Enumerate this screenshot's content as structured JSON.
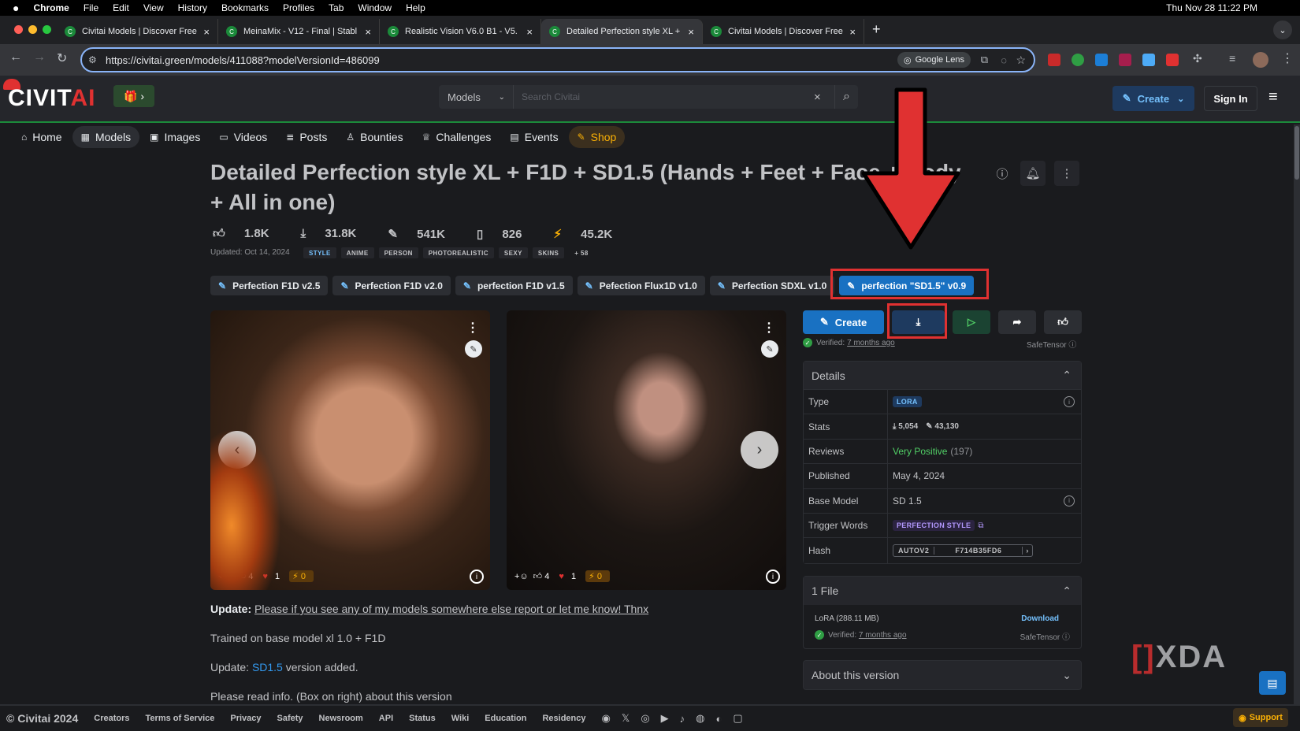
{
  "macbar": {
    "apple": "",
    "items": [
      "Chrome",
      "File",
      "Edit",
      "View",
      "History",
      "Bookmarks",
      "Profiles",
      "Tab",
      "Window",
      "Help"
    ],
    "clock": "Thu Nov 28  11:22 PM"
  },
  "browser": {
    "tabs": [
      {
        "label": "Civitai Models | Discover Free"
      },
      {
        "label": "MeinaMix - V12 - Final | Stabl"
      },
      {
        "label": "Realistic Vision V6.0 B1 - V5."
      },
      {
        "label": "Detailed Perfection style XL +"
      },
      {
        "label": "Civitai Models | Discover Free"
      }
    ],
    "active_tab": 3,
    "new_tab": "+",
    "url": "https://civitai.green/models/411088?modelVersionId=486099",
    "lens_label": "Google Lens"
  },
  "header": {
    "logo_a": "CIVIT",
    "logo_b": "AI",
    "seasonal": "🎁 ›",
    "search_select": "Models",
    "search_placeholder": "Search Civitai",
    "create_label": "Create",
    "signin_label": "Sign In"
  },
  "nav": {
    "items": [
      {
        "label": "Home",
        "icon": "⌂"
      },
      {
        "label": "Models",
        "icon": "▦"
      },
      {
        "label": "Images",
        "icon": "▣"
      },
      {
        "label": "Videos",
        "icon": "▭"
      },
      {
        "label": "Posts",
        "icon": "≣"
      },
      {
        "label": "Bounties",
        "icon": "♙"
      },
      {
        "label": "Challenges",
        "icon": "♕"
      },
      {
        "label": "Events",
        "icon": "▤"
      },
      {
        "label": "Shop",
        "icon": "✎"
      }
    ],
    "active": 1
  },
  "model": {
    "title": "Detailed Perfection style XL + F1D + SD1.5 (Hands + Feet + Face + Body + All in one)",
    "stats": {
      "likes": "1.8K",
      "downloads": "31.8K",
      "generations": "541K",
      "collected": "826",
      "buzz": "45.2K"
    },
    "updated": "Updated: Oct 14, 2024",
    "tags": [
      "STYLE",
      "ANIME",
      "PERSON",
      "PHOTOREALISTIC",
      "SEXY",
      "SKINS",
      "+ 58"
    ],
    "versions": [
      "Perfection F1D v2.5",
      "Perfection F1D v2.0",
      "perfection F1D v1.5",
      "Pefection Flux1D v1.0",
      "Perfection SDXL v1.0",
      "perfection \"SD1.5\" v0.9"
    ],
    "active_version": 5
  },
  "gallery": {
    "image1": {
      "reactions": {
        "add": "+☺",
        "likes": "4",
        "hearts": "1",
        "buzz": "0"
      }
    },
    "image2": {
      "reactions": {
        "add": "+☺",
        "likes": "4",
        "hearts": "1",
        "buzz": "0"
      }
    }
  },
  "description": {
    "update_label": "Update",
    "update_link": "Please if you see any of my models somewhere else report or let me know! Thnx",
    "trained": "Trained on base model xl 1.0 + F1D",
    "update2_pre": "Update: ",
    "update2_link": "SD1.5",
    "update2_post": " version added.",
    "read_info": "Please read info. (Box on right) about this version"
  },
  "actions": {
    "create_label": "Create",
    "verified_label": "Verified:",
    "verified_when": "7 months ago",
    "safetensor": "SafeTensor"
  },
  "details": {
    "title": "Details",
    "rows": {
      "type_k": "Type",
      "type_v": "LORA",
      "stats_k": "Stats",
      "stats_dl": "5,054",
      "stats_gen": "43,130",
      "reviews_k": "Reviews",
      "reviews_v": "Very Positive",
      "reviews_n": "(197)",
      "published_k": "Published",
      "published_v": "May 4, 2024",
      "base_k": "Base Model",
      "base_v": "SD 1.5",
      "trigger_k": "Trigger Words",
      "trigger_v": "PERFECTION STYLE",
      "hash_k": "Hash",
      "hash_type": "AUTOV2",
      "hash_v": "F714B35FD6"
    }
  },
  "files": {
    "title": "1 File",
    "file_name": "LoRA (288.11 MB)",
    "download": "Download",
    "verified_label": "Verified:",
    "verified_when": "7 months ago",
    "safetensor": "SafeTensor"
  },
  "about": {
    "title": "About this version"
  },
  "watermark": {
    "bracket": "[]",
    "text": "XDA"
  },
  "footer": {
    "copyright": "© Civitai 2024",
    "links": [
      "Creators",
      "Terms of Service",
      "Privacy",
      "Safety",
      "Newsroom",
      "API",
      "Status",
      "Wiki",
      "Education",
      "Residency"
    ],
    "support": "Support"
  },
  "colors": {
    "accent": "#1971c2",
    "brand_green": "#1b8a3a",
    "highlight_red": "#e03131",
    "background": "#1a1b1e"
  }
}
